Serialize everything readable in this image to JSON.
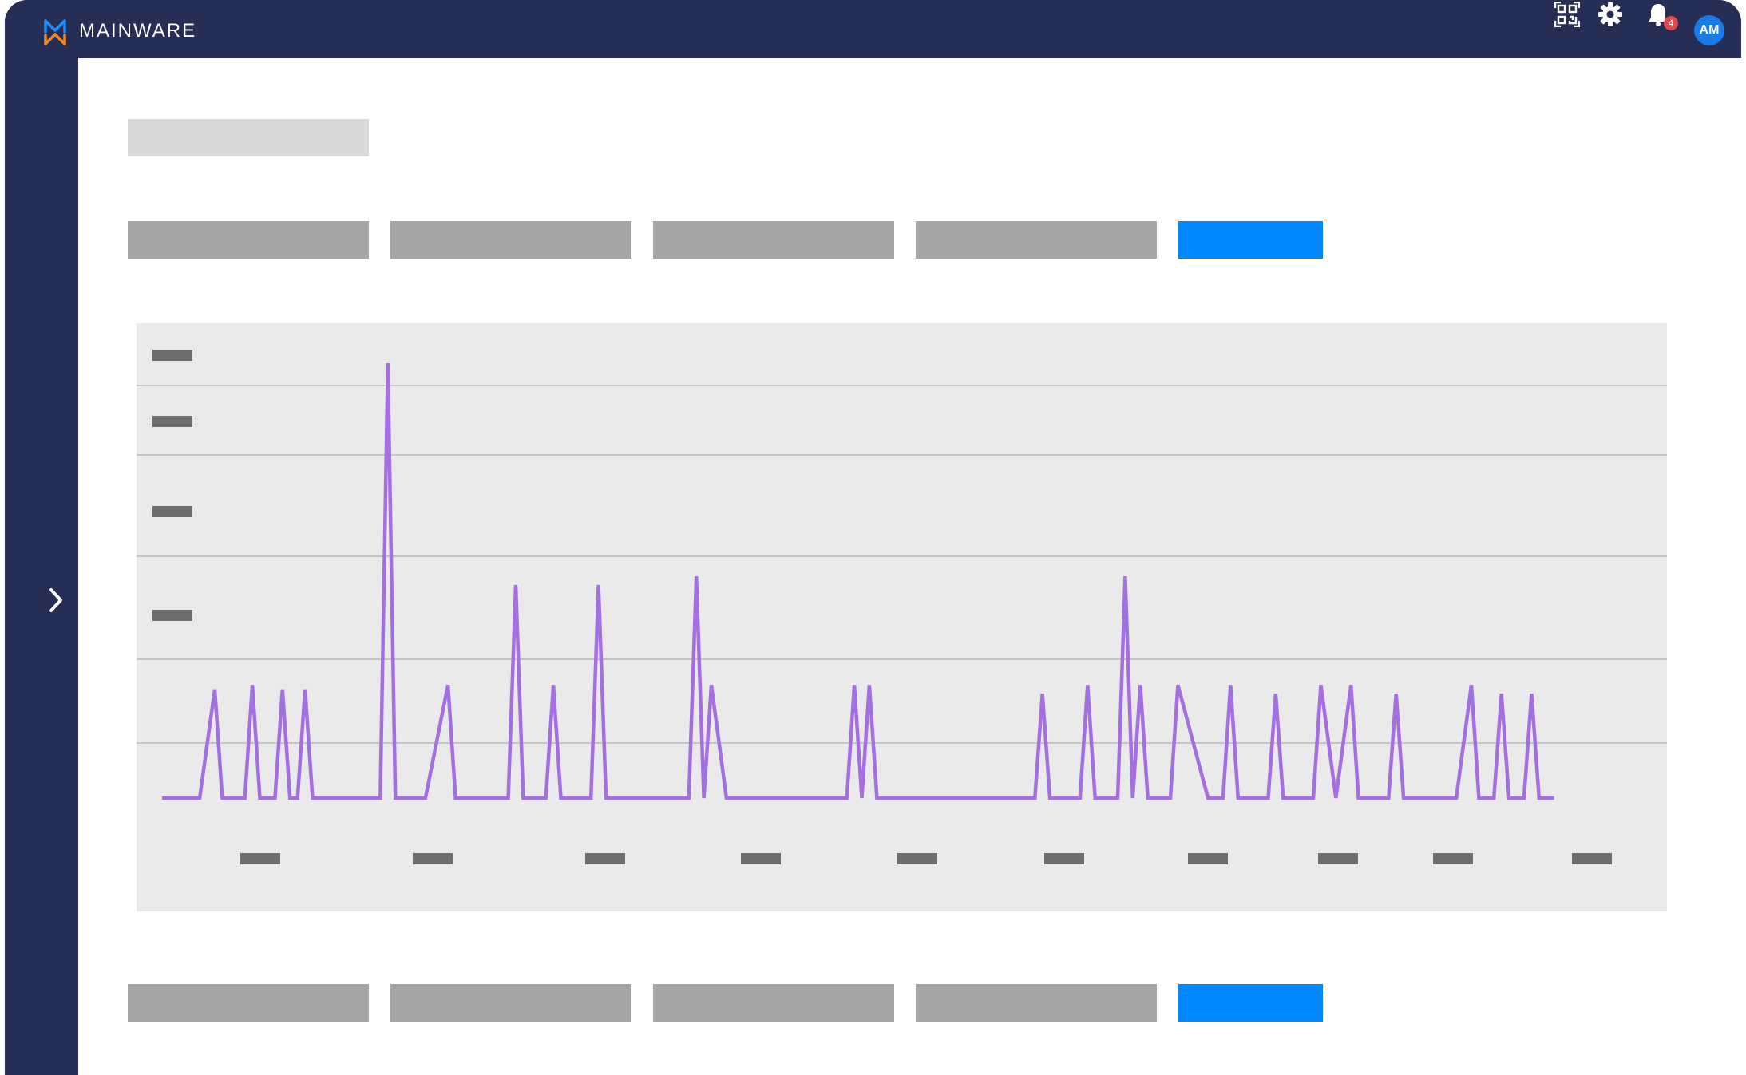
{
  "app": {
    "brand": "MAINWARE",
    "colors": {
      "nav_bg": "#262e55",
      "accent": "#0088ff",
      "series": "#a46fe0",
      "skeleton_light": "#d9d9d9",
      "skeleton": "#a6a6a6",
      "badge": "#e4484c",
      "avatar": "#1a7be6"
    }
  },
  "header": {
    "icons": [
      "qr-code-icon",
      "gear-icon",
      "bell-icon"
    ],
    "notification_count": "4",
    "avatar_initials": "AM"
  },
  "sidebar": {
    "toggle_icon": "chevron-right-icon"
  },
  "page": {
    "title": "",
    "tabs_top": [
      {
        "label": "",
        "active": false
      },
      {
        "label": "",
        "active": false
      },
      {
        "label": "",
        "active": false
      },
      {
        "label": "",
        "active": false
      },
      {
        "label": "",
        "active": true
      }
    ],
    "tabs_bottom": [
      {
        "label": "",
        "active": false
      },
      {
        "label": "",
        "active": false
      },
      {
        "label": "",
        "active": false
      },
      {
        "label": "",
        "active": false
      },
      {
        "label": "",
        "active": true
      }
    ]
  },
  "chart_data": {
    "type": "line",
    "grid": true,
    "y_tick_count": 4,
    "x_tick_count": 10,
    "ylim": [
      0,
      100
    ],
    "xlim": [
      0,
      200
    ],
    "series": [
      {
        "color": "#a46fe0",
        "points": [
          [
            0,
            0
          ],
          [
            5,
            0
          ],
          [
            7,
            25
          ],
          [
            8,
            0
          ],
          [
            11,
            0
          ],
          [
            12,
            26
          ],
          [
            13,
            0
          ],
          [
            15,
            0
          ],
          [
            16,
            25
          ],
          [
            17,
            0
          ],
          [
            18,
            0
          ],
          [
            19,
            25
          ],
          [
            20,
            0
          ],
          [
            29,
            0
          ],
          [
            30,
            100
          ],
          [
            31,
            0
          ],
          [
            35,
            0
          ],
          [
            38,
            26
          ],
          [
            39,
            0
          ],
          [
            46,
            0
          ],
          [
            47,
            49
          ],
          [
            48,
            0
          ],
          [
            51,
            0
          ],
          [
            52,
            26
          ],
          [
            53,
            0
          ],
          [
            57,
            0
          ],
          [
            58,
            49
          ],
          [
            59,
            0
          ],
          [
            70,
            0
          ],
          [
            71,
            51
          ],
          [
            72,
            0
          ],
          [
            73,
            26
          ],
          [
            75,
            0
          ],
          [
            91,
            0
          ],
          [
            92,
            26
          ],
          [
            93,
            0
          ],
          [
            94,
            26
          ],
          [
            95,
            0
          ],
          [
            116,
            0
          ],
          [
            117,
            24
          ],
          [
            118,
            0
          ],
          [
            122,
            0
          ],
          [
            123,
            26
          ],
          [
            124,
            0
          ],
          [
            127,
            0
          ],
          [
            128,
            51
          ],
          [
            129,
            0
          ],
          [
            130,
            26
          ],
          [
            131,
            0
          ],
          [
            134,
            0
          ],
          [
            135,
            26
          ],
          [
            139,
            0
          ],
          [
            141,
            0
          ],
          [
            142,
            26
          ],
          [
            143,
            0
          ],
          [
            147,
            0
          ],
          [
            148,
            24
          ],
          [
            149,
            0
          ],
          [
            153,
            0
          ],
          [
            154,
            26
          ],
          [
            156,
            0
          ],
          [
            158,
            26
          ],
          [
            159,
            0
          ],
          [
            163,
            0
          ],
          [
            164,
            24
          ],
          [
            165,
            0
          ],
          [
            172,
            0
          ],
          [
            174,
            26
          ],
          [
            175,
            0
          ],
          [
            177,
            0
          ],
          [
            178,
            24
          ],
          [
            179,
            0
          ],
          [
            181,
            0
          ],
          [
            182,
            24
          ],
          [
            183,
            0
          ],
          [
            185,
            0
          ]
        ]
      }
    ]
  }
}
